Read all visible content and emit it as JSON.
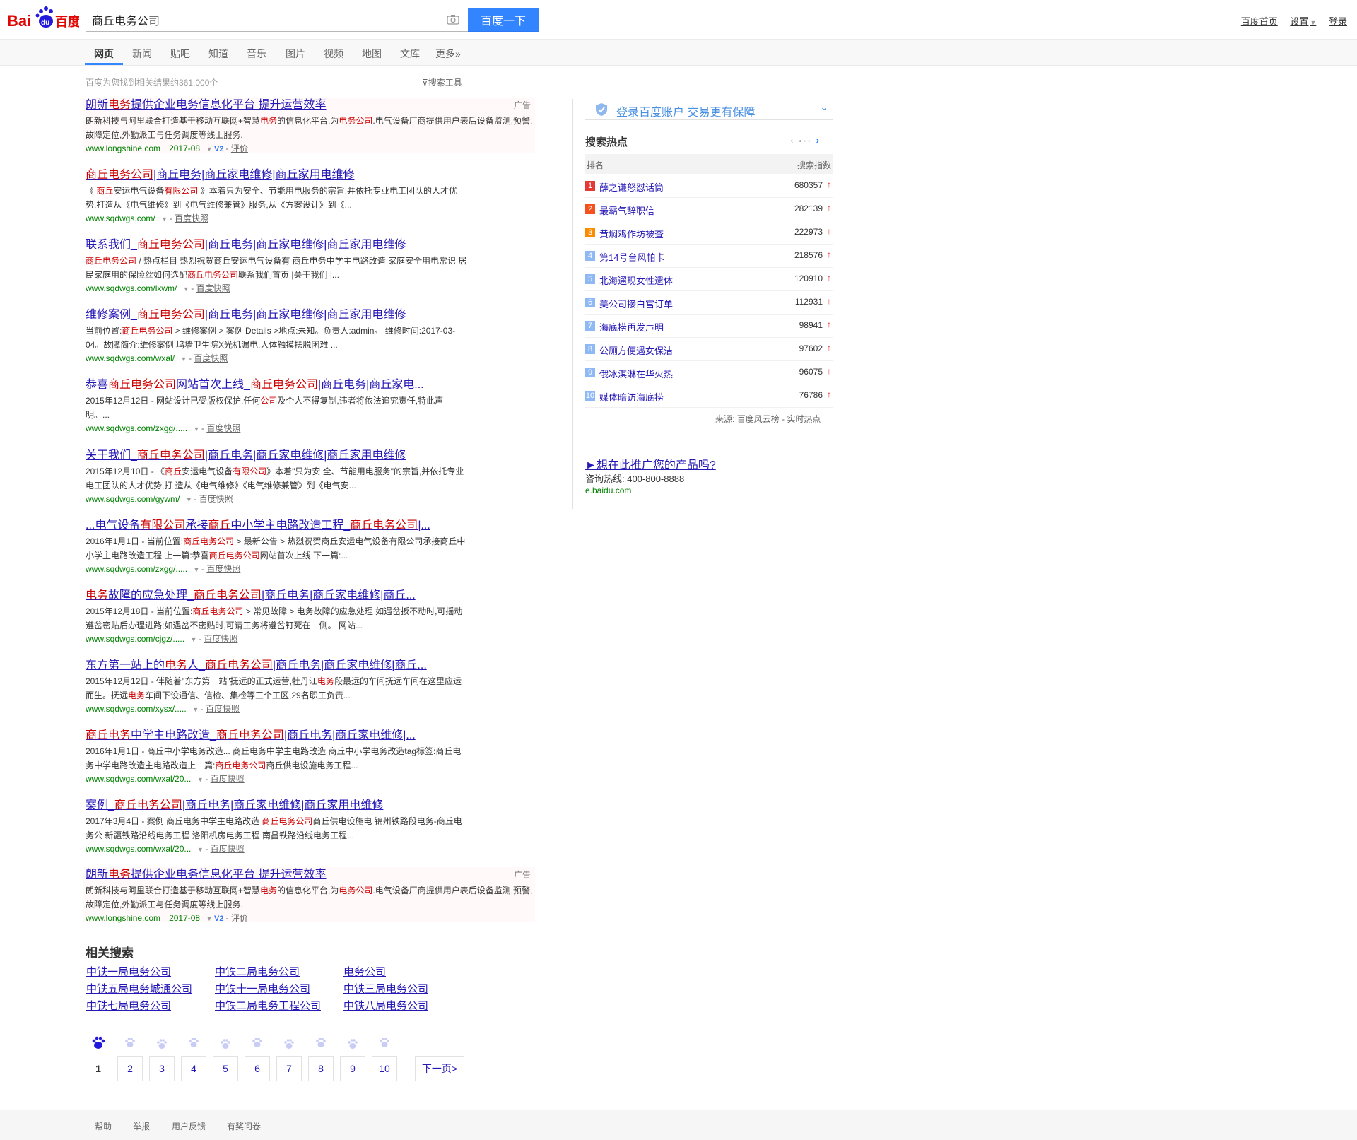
{
  "header": {
    "search_value": "商丘电务公司",
    "search_button": "百度一下",
    "links": [
      "百度首页",
      "设置",
      "登录"
    ]
  },
  "tabs": [
    "网页",
    "新闻",
    "贴吧",
    "知道",
    "音乐",
    "图片",
    "视频",
    "地图",
    "文库",
    "更多»"
  ],
  "stats": "百度为您找到相关结果约361,000个",
  "search_tools": "搜索工具",
  "results": [
    {
      "title_parts": [
        [
          "",
          "朗新"
        ],
        [
          "em",
          "电务"
        ],
        [
          "",
          "提供企业电务信息化平台 提升运营效率"
        ]
      ],
      "abstract_parts": [
        [
          "",
          "朗新科技与阿里联合打造基于移动互联网+智慧"
        ],
        [
          "em",
          "电务"
        ],
        [
          "",
          "的信息化平台,为"
        ],
        [
          "em",
          "电务公司"
        ],
        [
          "",
          ".电气设备厂商提供用户表后设备监测,预警,故障定位,外勤派工与任务调度等线上服务."
        ]
      ],
      "url": "www.longshine.com",
      "date": "2017-08",
      "extra": "评价",
      "ad": true,
      "ad_label": "广告"
    },
    {
      "title_parts": [
        [
          "em",
          "商丘电务公司"
        ],
        [
          "",
          "|商丘电务|商丘家电维修|商丘家用电维修"
        ]
      ],
      "abstract_parts": [
        [
          "",
          "《 "
        ],
        [
          "em",
          "商丘"
        ],
        [
          "",
          "安运电气设备"
        ],
        [
          "em",
          "有限公司"
        ],
        [
          "",
          " 》本着只为安全、节能用电服务的宗旨,并依托专业电工团队的人才优势,打造从《电气维修》到《电气维修兼管》服务,从《方案设计》到《..."
        ]
      ],
      "url": "www.sqdwgs.com/",
      "extra": "百度快照"
    },
    {
      "title_parts": [
        [
          "",
          "联系我们_"
        ],
        [
          "em",
          "商丘电务公司"
        ],
        [
          "",
          "|商丘电务|商丘家电维修|商丘家用电维修"
        ]
      ],
      "abstract_parts": [
        [
          "em",
          "商丘电务公司"
        ],
        [
          "",
          " / 热点栏目 热烈祝贺商丘安运电气设备有 商丘电务中学主电路改造 家庭安全用电常识 居民家庭用的保险丝如何选配"
        ],
        [
          "em",
          "商丘电务公司"
        ],
        [
          "",
          "联系我们首页 |关于我们 |..."
        ]
      ],
      "url": "www.sqdwgs.com/lxwm/",
      "extra": "百度快照"
    },
    {
      "title_parts": [
        [
          "",
          "维修案例_"
        ],
        [
          "em",
          "商丘电务公司"
        ],
        [
          "",
          "|商丘电务|商丘家电维修|商丘家用电维修"
        ]
      ],
      "abstract_parts": [
        [
          "",
          "当前位置:"
        ],
        [
          "em",
          "商丘电务公司"
        ],
        [
          "",
          " > 维修案例 > 案例 Details >地点:未知。负责人:admin。 维修时间:2017-03-04。故障简介:维修案例 坞墙卫生院X光机漏电,人体触摸摆脱困难 ..."
        ]
      ],
      "url": "www.sqdwgs.com/wxal/",
      "extra": "百度快照"
    },
    {
      "title_parts": [
        [
          "",
          "恭喜"
        ],
        [
          "em",
          "商丘电务公司"
        ],
        [
          "",
          "网站首次上线_"
        ],
        [
          "em",
          "商丘电务公司"
        ],
        [
          "",
          "|商丘电务|商丘家电..."
        ]
      ],
      "abstract_parts": [
        [
          "",
          "2015年12月12日 - 网站设计已受版权保护,任何"
        ],
        [
          "em",
          "公司"
        ],
        [
          "",
          "及个人不得复制,违者将依法追究责任,特此声明。..."
        ]
      ],
      "url": "www.sqdwgs.com/zxgg/.....",
      "extra": "百度快照"
    },
    {
      "title_parts": [
        [
          "",
          "关于我们_"
        ],
        [
          "em",
          "商丘电务公司"
        ],
        [
          "",
          "|商丘电务|商丘家电维修|商丘家用电维修"
        ]
      ],
      "abstract_parts": [
        [
          "",
          "2015年12月10日 - 《"
        ],
        [
          "em",
          "商丘"
        ],
        [
          "",
          "安运电气设备"
        ],
        [
          "em",
          "有限公司"
        ],
        [
          "",
          "》本着\"只为安 全、节能用电服务\"的宗旨,并依托专业电工团队的人才优势,打 造从《电气维修》《电气维修兼管》到《电气安..."
        ]
      ],
      "url": "www.sqdwgs.com/gywm/",
      "extra": "百度快照"
    },
    {
      "title_parts": [
        [
          "",
          "...电气设备"
        ],
        [
          "em",
          "有限公司"
        ],
        [
          "",
          "承接"
        ],
        [
          "em",
          "商丘"
        ],
        [
          "",
          "中小学主电路改造工程_"
        ],
        [
          "em",
          "商丘电务公司"
        ],
        [
          "",
          "|..."
        ]
      ],
      "abstract_parts": [
        [
          "",
          "2016年1月1日 - 当前位置:"
        ],
        [
          "em",
          "商丘电务公司"
        ],
        [
          "",
          " > 最新公告 > 热烈祝贺商丘安运电气设备有限公司承接商丘中小学主电路改造工程 上一篇:恭喜"
        ],
        [
          "em",
          "商丘电务公司"
        ],
        [
          "",
          "网站首次上线 下一篇:..."
        ]
      ],
      "url": "www.sqdwgs.com/zxgg/.....",
      "extra": "百度快照"
    },
    {
      "title_parts": [
        [
          "em",
          "电务"
        ],
        [
          "",
          "故障的应急处理_"
        ],
        [
          "em",
          "商丘电务公司"
        ],
        [
          "",
          "|商丘电务|商丘家电维修|商丘..."
        ]
      ],
      "abstract_parts": [
        [
          "",
          "2015年12月18日 - 当前位置:"
        ],
        [
          "em",
          "商丘电务公司"
        ],
        [
          "",
          " > 常见故障 > 电务故障的应急处理 如遇岔扳不动时,可摇动遵岔密贴后办理进路;如遇岔不密贴时,可请工务将遵岔钉死在一侧。 网站..."
        ]
      ],
      "url": "www.sqdwgs.com/cjgz/.....",
      "extra": "百度快照"
    },
    {
      "title_parts": [
        [
          "",
          "东方第一站上的"
        ],
        [
          "em",
          "电务"
        ],
        [
          "",
          "人_"
        ],
        [
          "em",
          "商丘电务公司"
        ],
        [
          "",
          "|商丘电务|商丘家电维修|商丘..."
        ]
      ],
      "abstract_parts": [
        [
          "",
          "2015年12月12日 - 伴随着\"东方第一站\"抚远的正式运营,牡丹江"
        ],
        [
          "em",
          "电务"
        ],
        [
          "",
          "段最远的车间抚远车间在这里应运而生。抚远"
        ],
        [
          "em",
          "电务"
        ],
        [
          "",
          "车间下设通信、信检、集检等三个工区,29名职工负责..."
        ]
      ],
      "url": "www.sqdwgs.com/xysx/.....",
      "extra": "百度快照"
    },
    {
      "title_parts": [
        [
          "em",
          "商丘电务"
        ],
        [
          "",
          "中学主电路改造_"
        ],
        [
          "em",
          "商丘电务公司"
        ],
        [
          "",
          "|商丘电务|商丘家电维修|..."
        ]
      ],
      "abstract_parts": [
        [
          "",
          "2016年1月1日 - 商丘中小学电务改造... 商丘电务中学主电路改造 商丘中小学电务改造tag标签:商丘电务中学电路改造主电路改造上一篇:"
        ],
        [
          "em",
          "商丘电务公司"
        ],
        [
          "",
          "商丘供电设施电务工程..."
        ]
      ],
      "url": "www.sqdwgs.com/wxal/20...",
      "extra": "百度快照"
    },
    {
      "title_parts": [
        [
          "",
          "案例_"
        ],
        [
          "em",
          "商丘电务公司"
        ],
        [
          "",
          "|商丘电务|商丘家电维修|商丘家用电维修"
        ]
      ],
      "abstract_parts": [
        [
          "",
          "2017年3月4日 - 案例 商丘电务中学主电路改造 "
        ],
        [
          "em",
          "商丘电务公司"
        ],
        [
          "",
          "商丘供电设施电 锦州铁路段电务-商丘电务公 新疆铁路沿线电务工程 洛阳机房电务工程 南昌铁路沿线电务工程..."
        ]
      ],
      "url": "www.sqdwgs.com/wxal/20...",
      "extra": "百度快照"
    },
    {
      "title_parts": [
        [
          "",
          "朗新"
        ],
        [
          "em",
          "电务"
        ],
        [
          "",
          "提供企业电务信息化平台 提升运营效率"
        ]
      ],
      "abstract_parts": [
        [
          "",
          "朗新科技与阿里联合打造基于移动互联网+智慧"
        ],
        [
          "em",
          "电务"
        ],
        [
          "",
          "的信息化平台,为"
        ],
        [
          "em",
          "电务公司"
        ],
        [
          "",
          ".电气设备厂商提供用户表后设备监测,预警,故障定位,外勤派工与任务调度等线上服务."
        ]
      ],
      "url": "www.longshine.com",
      "date": "2017-08",
      "extra": "评价",
      "ad": true,
      "ad_label": "广告"
    }
  ],
  "related": {
    "title": "相关搜索",
    "items": [
      "中铁一局电务公司",
      "中铁二局电务公司",
      "电务公司",
      "中铁五局电务城通公司",
      "中铁十一局电务公司",
      "中铁三局电务公司",
      "中铁七局电务公司",
      "中铁二局电务工程公司",
      "中铁八局电务公司"
    ]
  },
  "pager": {
    "current": "1",
    "pages": [
      "2",
      "3",
      "4",
      "5",
      "6",
      "7",
      "8",
      "9",
      "10"
    ],
    "next": "下一页>"
  },
  "sidebar": {
    "login_text": "登录百度账户  交易更有保障",
    "hot_title": "搜索热点",
    "col_rank": "排名",
    "col_index": "搜索指数",
    "hot_items": [
      {
        "rank": "1",
        "name": "薛之谦怒怼话筒",
        "value": "680357",
        "color": "#e53935"
      },
      {
        "rank": "2",
        "name": "最霸气辞职信",
        "value": "282139",
        "color": "#f4511e"
      },
      {
        "rank": "3",
        "name": "黄焖鸡作坊被查",
        "value": "222973",
        "color": "#fb8c00"
      },
      {
        "rank": "4",
        "name": "第14号台风帕卡",
        "value": "218576",
        "color": "#8eb9f5"
      },
      {
        "rank": "5",
        "name": "北海遛现女性遗体",
        "value": "120910",
        "color": "#8eb9f5"
      },
      {
        "rank": "6",
        "name": "美公司接白宫订单",
        "value": "112931",
        "color": "#8eb9f5"
      },
      {
        "rank": "7",
        "name": "海底捞再发声明",
        "value": "98941",
        "color": "#8eb9f5"
      },
      {
        "rank": "8",
        "name": "公厕方便遇女保洁",
        "value": "97602",
        "color": "#8eb9f5"
      },
      {
        "rank": "9",
        "name": "俄冰淇淋在华火热",
        "value": "96075",
        "color": "#8eb9f5"
      },
      {
        "rank": "10",
        "name": "媒体暗访海底捞",
        "value": "76786",
        "color": "#8eb9f5"
      }
    ],
    "source_label": "来源:",
    "source_link1": "百度风云榜",
    "source_sep": "-",
    "source_link2": "实时热点",
    "promo_link": "►想在此推广您的产品吗?",
    "promo_phone": "咨询热线: 400-800-8888",
    "promo_url": "e.baidu.com"
  },
  "footer": [
    "帮助",
    "举报",
    "用户反馈",
    "有奖问卷"
  ],
  "colors": {
    "accent": "#3385ff",
    "link": "#2518b5",
    "highlight": "#c00000",
    "url": "#008000"
  }
}
